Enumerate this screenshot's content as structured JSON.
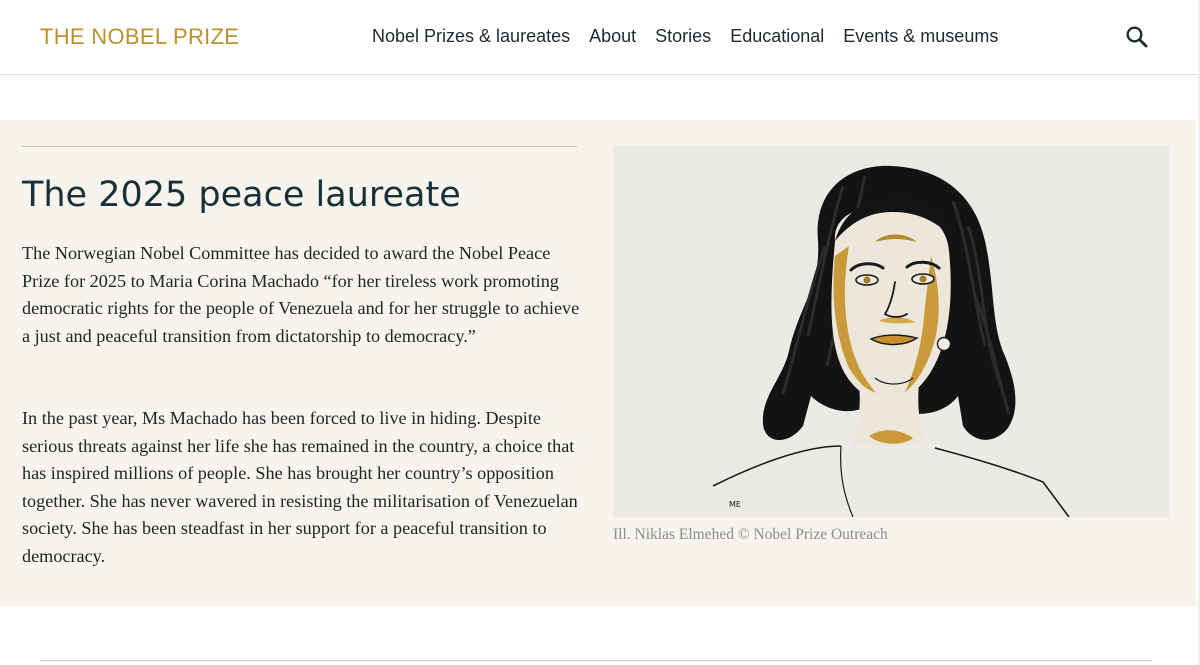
{
  "header": {
    "logo": "THE NOBEL PRIZE",
    "nav": [
      "Nobel Prizes & laureates",
      "About",
      "Stories",
      "Educational",
      "Events & museums"
    ],
    "search_icon": "search-icon"
  },
  "feature": {
    "title": "The 2025 peace laureate",
    "paragraph1": "The Norwegian Nobel Committee has decided to award the Nobel Peace Prize for 2025 to Maria Corina Machado “for her tireless work promoting democratic rights for the people of Venezuela and for her struggle to achieve a just and peaceful transition from dictatorship to democracy.”",
    "paragraph2": "In the past year, Ms Machado has been forced to live in hiding. Despite serious threats against her life she has remained in the country, a choice that has inspired millions of people. She has brought her country’s opposition together. She has never wavered in resisting the militarisation of Venezuelan society. She has been steadfast in her support for a peaceful transition to democracy.",
    "image_caption": "Ill. Niklas Elmehed © Nobel Prize Outreach",
    "illustration_initials": "ME"
  },
  "colors": {
    "brand_gold": "#b8922f",
    "band_background": "#f7f3ed",
    "title_color": "#183038"
  }
}
